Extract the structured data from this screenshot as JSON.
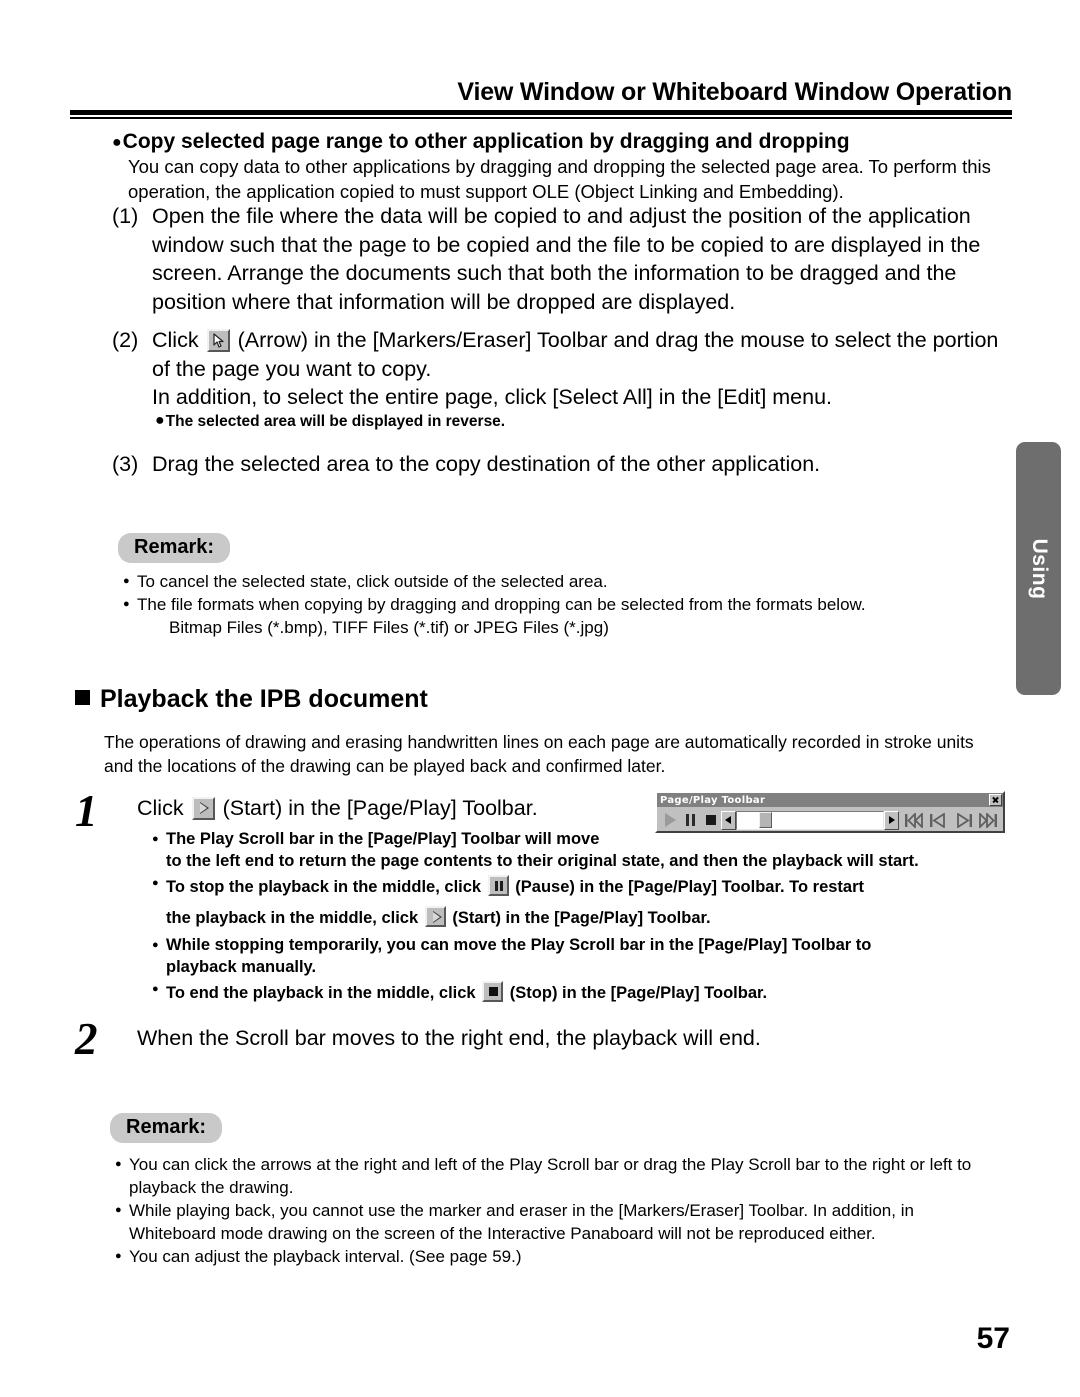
{
  "header": {
    "title": "View Window or Whiteboard Window Operation"
  },
  "section_copy": {
    "heading": "Copy selected page range to other application by dragging and dropping",
    "intro": "You can copy data to other applications by dragging and dropping the selected page area. To perform this operation, the application copied to must support OLE (Object Linking and Embedding).",
    "steps": [
      {
        "number": "(1)",
        "text": "Open the file where the data will be copied to and adjust the position of the application window such that the page to be copied and the file to be copied to are displayed in the screen. Arrange the documents such that both the information to be dragged and the position where that information will be dropped are displayed."
      },
      {
        "number": "(2)",
        "text_before_icon": "Click",
        "icon": "arrow-cursor-icon",
        "text_after_icon": "(Arrow) in the [Markers/Eraser] Toolbar and drag the mouse to select the portion of the page you want to copy.",
        "text_line3": "In addition, to select the entire page, click [Select All] in the [Edit] menu."
      },
      {
        "number": "(3)",
        "text": "Drag the selected area to the copy destination of the other application."
      }
    ],
    "subnote": "The selected area will be displayed in reverse.",
    "remark_label": "Remark:",
    "remark_items": [
      "To cancel the selected state, click outside of the selected area.",
      "The file formats when copying by dragging and dropping can be selected from the formats below."
    ],
    "remark_sub": "Bitmap Files (*.bmp), TIFF Files (*.tif) or JPEG Files (*.jpg)"
  },
  "side_tab": {
    "label": "Using"
  },
  "section_playback": {
    "heading": "Playback the IPB document",
    "intro": "The operations of drawing and erasing handwritten lines on each page are automatically recorded in stroke units and the locations of the drawing can be played back and confirmed later.",
    "step1": {
      "number": "1",
      "text_before_icon": "Click",
      "icon": "play-icon",
      "text_after_icon": "(Start) in the [Page/Play] Toolbar.",
      "notes": [
        {
          "line1": "The Play Scroll bar in the [Page/Play] Toolbar will move",
          "line2": "to the left end to return the page contents to their original state, and then the playback will start."
        },
        {
          "line1_before": "To stop the playback in the middle, click",
          "icon1": "pause-icon",
          "line1_after": "(Pause) in the [Page/Play] Toolbar. To restart",
          "line2_before": "the playback in the middle, click",
          "icon2": "play-icon",
          "line2_after": "(Start) in the [Page/Play] Toolbar."
        },
        {
          "line1": "While stopping temporarily, you can move the Play Scroll bar in the [Page/Play] Toolbar to",
          "line2": "playback manually."
        },
        {
          "line1_before": "To end the playback in the middle, click",
          "icon1": "stop-icon",
          "line1_after": "(Stop) in the [Page/Play] Toolbar."
        }
      ]
    },
    "step2": {
      "number": "2",
      "text": "When the Scroll bar moves to the right end, the playback will end."
    },
    "remark_label": "Remark:",
    "remark_items": [
      {
        "line1": "You can click the arrows at the right and left of the Play Scroll bar or drag the Play Scroll bar to the right or left to",
        "line2": "playback the drawing."
      },
      {
        "line1": "While playing back, you cannot use the marker and eraser in the [Markers/Eraser] Toolbar. In addition, in",
        "line2": "Whiteboard mode drawing on the screen of the Interactive Panaboard will not be reproduced either."
      },
      {
        "line1": "You can adjust the playback interval. (See page 59.)",
        "line2": ""
      }
    ]
  },
  "page_play_toolbar": {
    "title": "Page/Play Toolbar",
    "close_icon": "close-icon",
    "buttons": [
      {
        "name": "play-button",
        "icon": "play-icon"
      },
      {
        "name": "pause-button",
        "icon": "pause-icon"
      },
      {
        "name": "stop-button",
        "icon": "stop-icon"
      }
    ],
    "scrollbar": {
      "left_arrow": "scroll-left-arrow-icon",
      "right_arrow": "scroll-right-arrow-icon",
      "thumb": "scroll-thumb"
    },
    "nav_buttons": [
      {
        "name": "first-page-button",
        "icon": "skip-to-start-icon"
      },
      {
        "name": "previous-page-button",
        "icon": "step-back-icon"
      },
      {
        "name": "next-page-button",
        "icon": "step-forward-icon"
      },
      {
        "name": "last-page-button",
        "icon": "skip-to-end-icon"
      }
    ]
  },
  "footer": {
    "page_number": "57"
  },
  "colors": {
    "side_tab_bg": "#6e6e6e",
    "remark_pill_bg": "#c9c9c9",
    "toolbar_bg": "#c0c0c0",
    "toolbar_title_bg": "#808080"
  }
}
